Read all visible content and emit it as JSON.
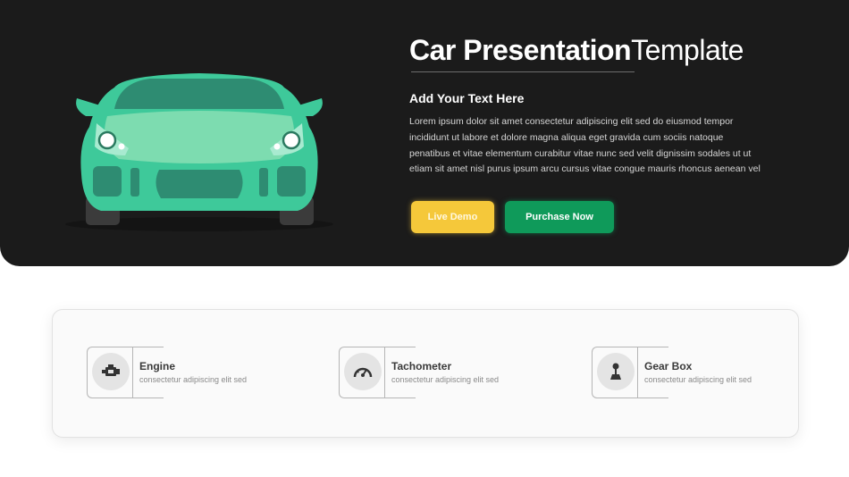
{
  "hero": {
    "title_bold": "Car Presentation",
    "title_light": "Template",
    "subtitle": "Add Your Text Here",
    "body_lines": [
      "Lorem ipsum dolor sit amet consectetur adipiscing elit sed do  eiusmod tempor",
      "incididunt ut labore et dolore magna aliqua eget gravida cum sociis natoque",
      "penatibus et vitae elementum curabitur vitae nunc sed velit dignissim sodales ut ut",
      "etiam sit amet nisl purus  ipsum arcu cursus vitae congue mauris rhoncus aenean vel"
    ],
    "buttons": {
      "demo_label": "Live Demo",
      "buy_label": "Purchase Now"
    }
  },
  "features": [
    {
      "name": "Engine",
      "desc": "consectetur adipiscing elit sed",
      "icon": "engine-icon"
    },
    {
      "name": "Tachometer",
      "desc": "consectetur adipiscing elit sed",
      "icon": "tachometer-icon"
    },
    {
      "name": "Gear Box",
      "desc": "consectetur adipiscing elit sed",
      "icon": "gear-shift-icon"
    }
  ],
  "colors": {
    "hero_bg": "#1b1b1b",
    "car_body": "#3ec99a",
    "demo_button": "#f5c83a",
    "buy_button": "#0f9a5a"
  }
}
